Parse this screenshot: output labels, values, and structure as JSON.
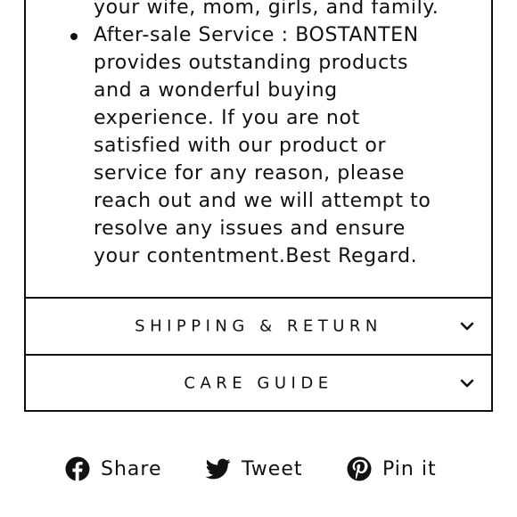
{
  "description": {
    "lines": [
      "your wife, mom, girls, and family.",
      "After-sale Service : BOSTANTEN",
      "provides outstanding products",
      "and a wonderful buying",
      "experience. If you are not",
      "satisfied with our product or",
      "service for any reason, please",
      "reach out and we will attempt to",
      "resolve any issues and ensure",
      "your contentment.Best Regard."
    ]
  },
  "accordion": {
    "shipping_label": "SHIPPING & RETURN",
    "care_label": "CARE GUIDE"
  },
  "share": {
    "facebook_label": "Share",
    "twitter_label": "Tweet",
    "pinterest_label": "Pin it"
  },
  "icons": {
    "facebook": "facebook-icon",
    "twitter": "twitter-icon",
    "pinterest": "pinterest-icon",
    "chevron": "chevron-down-icon"
  },
  "colors": {
    "text": "#111111",
    "border": "#111111",
    "background": "#ffffff"
  }
}
